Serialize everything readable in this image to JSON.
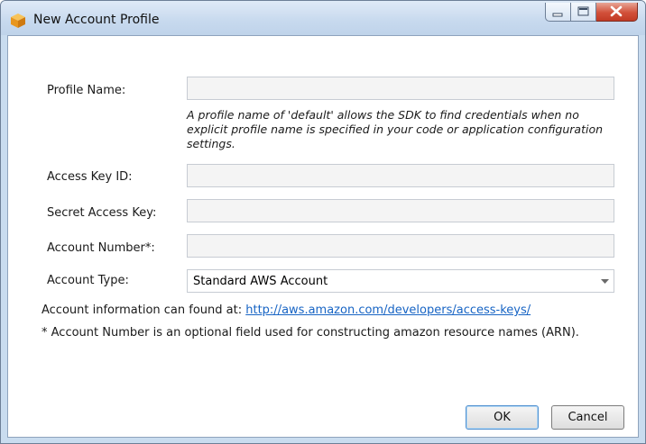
{
  "window": {
    "title": "New Account Profile",
    "icons": {
      "app": "aws-cube-icon",
      "minimize": "minimize-icon",
      "maximize": "maximize-icon",
      "close": "close-icon"
    }
  },
  "form": {
    "profile_name": {
      "label": "Profile Name:",
      "value": ""
    },
    "profile_note": "A profile name of 'default' allows the SDK to find credentials when no explicit profile name is specified in your code or application configuration settings.",
    "access_key_id": {
      "label": "Access Key ID:",
      "value": ""
    },
    "secret_access_key": {
      "label": "Secret Access Key:",
      "value": ""
    },
    "account_number": {
      "label": "Account Number*:",
      "value": ""
    },
    "account_type": {
      "label": "Account Type:",
      "selected": "Standard AWS Account"
    }
  },
  "info": {
    "prefix": "Account information can found at:",
    "link": "http://aws.amazon.com/developers/access-keys/",
    "footnote": "* Account Number is an optional field used for constructing amazon resource names (ARN)."
  },
  "buttons": {
    "ok": "OK",
    "cancel": "Cancel"
  },
  "colors": {
    "link": "#1764c4",
    "title_bar": "#c9dcef",
    "close": "#d2503a"
  }
}
